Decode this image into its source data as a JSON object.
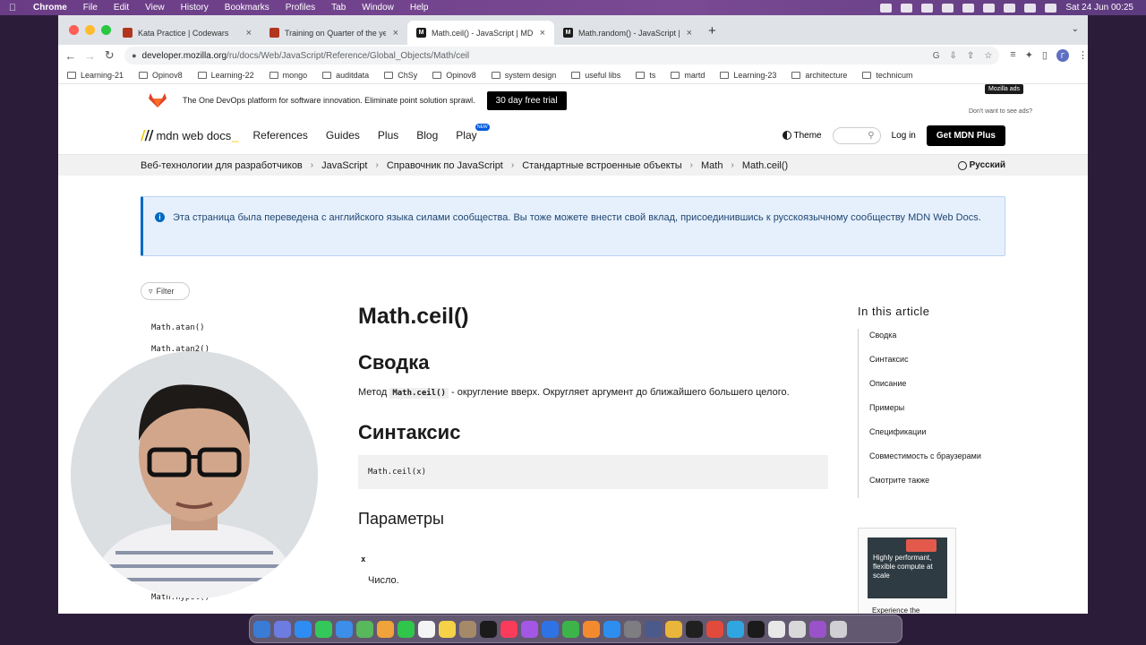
{
  "menubar": {
    "app": "Chrome",
    "items": [
      "File",
      "Edit",
      "View",
      "History",
      "Bookmarks",
      "Profiles",
      "Tab",
      "Window",
      "Help"
    ],
    "datetime": "Sat 24 Jun  00:25"
  },
  "tabs": [
    {
      "title": "Kata Practice | Codewars",
      "favicon_color": "#b1361e"
    },
    {
      "title": "Training on Quarter of the year",
      "favicon_color": "#b1361e"
    },
    {
      "title": "Math.ceil() - JavaScript | MDN",
      "favicon_color": "#1b1b1b",
      "active": true
    },
    {
      "title": "Math.random() - JavaScript | M",
      "favicon_color": "#1b1b1b"
    }
  ],
  "address": {
    "host": "developer.mozilla.org",
    "path": "/ru/docs/Web/JavaScript/Reference/Global_Objects/Math/ceil"
  },
  "profile_initial": "Г",
  "bookmarks": [
    "Learning-21",
    "Opinov8",
    "Learning-22",
    "mongo",
    "auditdata",
    "ChSy",
    "Opinov8",
    "system design",
    "useful libs",
    "ts",
    "martd",
    "Learning-23",
    "architecture",
    "technicum"
  ],
  "ad": {
    "text": "The One DevOps platform for software innovation. Eliminate point solution sprawl.",
    "cta": "30 day free trial",
    "badge": "Mozilla ads",
    "dont_want": "Don't want to see ads?"
  },
  "header": {
    "logo": "mdn web docs",
    "nav": [
      "References",
      "Guides",
      "Plus",
      "Blog",
      "Play"
    ],
    "new_badge": "NEW",
    "theme": "Theme",
    "login": "Log in",
    "get_plus": "Get MDN Plus"
  },
  "breadcrumbs": [
    "Веб-технологии для разработчиков",
    "JavaScript",
    "Справочник по JavaScript",
    "Стандартные встроенные объекты",
    "Math",
    "Math.ceil()"
  ],
  "language": "Русский",
  "notice": "Эта страница была переведена с английского языка силами сообщества. Вы тоже можете внести свой вклад, присоединившись к русскоязычному сообществу MDN Web Docs.",
  "sidebar": {
    "filter": "Filter",
    "items": [
      "Math.atan()",
      "Math.atan2()",
      "Math.hypot()"
    ]
  },
  "article": {
    "title": "Math.ceil()",
    "summary_heading": "Сводка",
    "summary_prefix": "Метод",
    "summary_code": "Math.ceil()",
    "summary_suffix": "- округление вверх. Округляет аргумент до ближайшего большего целого.",
    "syntax_heading": "Синтаксис",
    "syntax_code": "Math.ceil(x)",
    "params_heading": "Параметры",
    "param_name": "x",
    "param_desc": "Число."
  },
  "toc": {
    "heading": "In this article",
    "items": [
      "Сводка",
      "Синтаксис",
      "Описание",
      "Примеры",
      "Спецификации",
      "Совместимость с браузерами",
      "Смотрите также"
    ]
  },
  "side_ad": {
    "text": "Highly performant, flexible compute at scale",
    "caption": "Experience the"
  }
}
